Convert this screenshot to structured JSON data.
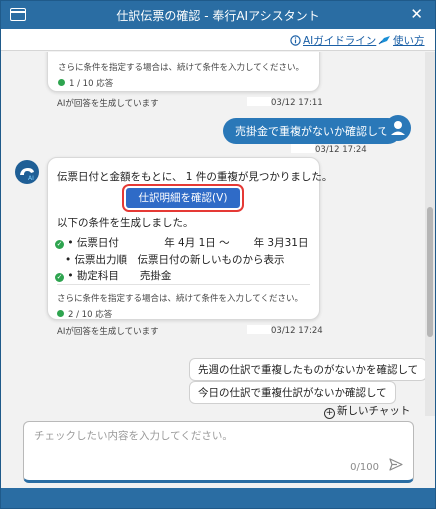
{
  "window": {
    "title": "仕訳伝票の確認 - 奉行AIアシスタント",
    "close_glyph": "✕"
  },
  "links": {
    "guide": "AIガイドライン",
    "howto": "使い方"
  },
  "prev_message": {
    "text": "さらに条件を指定する場合は、続けて条件を入力してください。",
    "count": "1 / 10 応答",
    "status": "AIが回答を生成しています",
    "timestamp": "03/12 17:11"
  },
  "user_message": {
    "text": "売掛金で重複がないか確認して",
    "timestamp": "03/12 17:24"
  },
  "ai_message": {
    "intro": "伝票日付と金額をもとに、 1 件の重複が見つかりました。",
    "confirm_button": "仕訳明細を確認(V)",
    "conditions_heading": "以下の条件を生成しました。",
    "cond1_label": "• 伝票日付",
    "cond1_from": "年 4月 1日 ～",
    "cond1_to": "年 3月31日",
    "cond2": "• 伝票出力順　伝票日付の新しいものから表示",
    "cond3": "• 勘定科目　　売掛金",
    "more_text": "さらに条件を指定する場合は、続けて条件を入力してください。",
    "count": "2 / 10 応答",
    "status": "AIが回答を生成しています",
    "timestamp": "03/12 17:24"
  },
  "suggestions": [
    "先週の仕訳で重複したものがないかを確認して",
    "今日の仕訳で重複仕訳がないか確認して"
  ],
  "new_chat": "新しいチャット",
  "input": {
    "placeholder": "チェックしたい内容を入力してください。",
    "counter": "0/100"
  },
  "colors": {
    "titlebar": "#2a6da3",
    "accent": "#2a78b8",
    "button": "#2f6bc7",
    "highlight": "#e53935",
    "status_dot": "#2ea44f"
  },
  "icons": [
    "window-icon",
    "close-icon",
    "guideline-icon",
    "howto-icon",
    "user-avatar-icon",
    "ai-avatar-icon",
    "check-icon",
    "plus-icon",
    "send-icon"
  ]
}
